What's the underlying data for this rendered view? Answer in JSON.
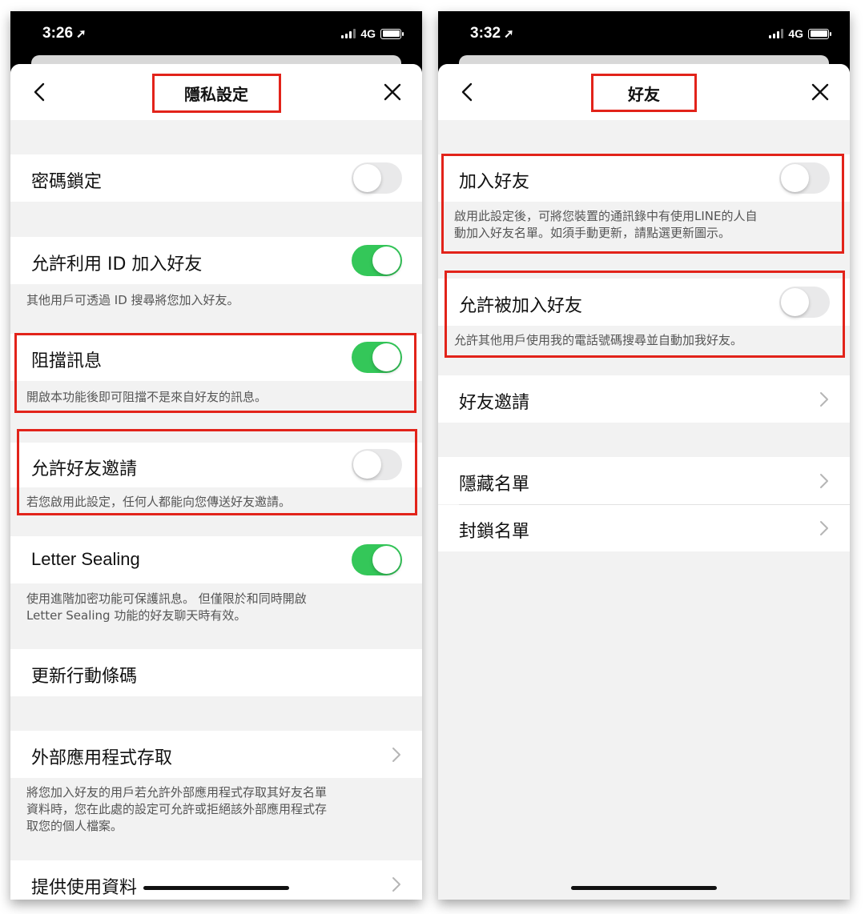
{
  "colors": {
    "accent_green": "#34c759",
    "highlight_red": "#e2231a",
    "toggle_off": "#e9e9ea"
  },
  "left": {
    "status": {
      "time": "3:26",
      "network": "4G"
    },
    "nav": {
      "title": "隱私設定"
    },
    "passcode": {
      "label": "密碼鎖定",
      "toggle": "off"
    },
    "allow_id": {
      "label": "允許利用 ID 加入好友",
      "toggle": "on",
      "desc": "其他用戶可透過 ID 搜尋將您加入好友。"
    },
    "block_messages": {
      "label": "阻擋訊息",
      "toggle": "on",
      "desc": "開啟本功能後即可阻擋不是來自好友的訊息。"
    },
    "allow_invites": {
      "label": "允許好友邀請",
      "toggle": "off",
      "desc": "若您啟用此設定，任何人都能向您傳送好友邀請。"
    },
    "letter_sealing": {
      "label": "Letter Sealing",
      "toggle": "on",
      "desc_line1": "使用進階加密功能可保護訊息。 但僅限於和同時開啟",
      "desc_line2": "Letter Sealing 功能的好友聊天時有效。"
    },
    "update_code": {
      "label": "更新行動條碼"
    },
    "external_apps": {
      "label": "外部應用程式存取",
      "desc_line1": "將您加入好友的用戶若允許外部應用程式存取其好友名單",
      "desc_line2": "資料時，您在此處的設定可允許或拒絕該外部應用程式存",
      "desc_line3": "取您的個人檔案。"
    },
    "provide_data": {
      "label": "提供使用資料"
    }
  },
  "right": {
    "status": {
      "time": "3:32",
      "network": "4G"
    },
    "nav": {
      "title": "好友"
    },
    "auto_add": {
      "label": "加入好友",
      "toggle": "off",
      "desc_line1": "啟用此設定後，可將您裝置的通訊錄中有使用LINE的人自",
      "desc_line2": "動加入好友名單。如須手動更新，請點選更新圖示。"
    },
    "allow_added": {
      "label": "允許被加入好友",
      "toggle": "off",
      "desc": "允許其他用戶使用我的電話號碼搜尋並自動加我好友。"
    },
    "friend_invites": {
      "label": "好友邀請"
    },
    "hidden_list": {
      "label": "隱藏名單"
    },
    "blocked_list": {
      "label": "封鎖名單"
    }
  }
}
